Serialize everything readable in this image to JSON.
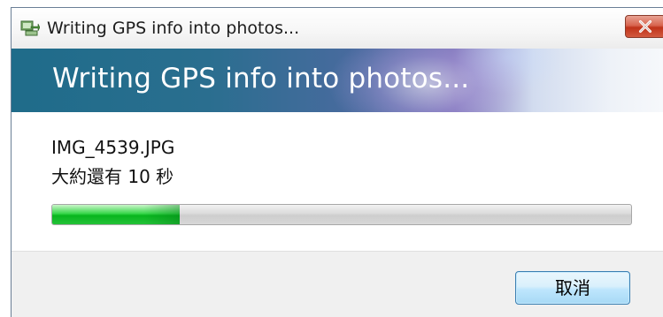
{
  "window": {
    "title": "Writing GPS info into photos...",
    "app_icon": "photo-gps-icon",
    "close_icon": "close-icon"
  },
  "banner": {
    "title": "Writing GPS info into photos..."
  },
  "status": {
    "filename": "IMG_4539.JPG",
    "time_remaining": "大約還有 10 秒"
  },
  "progress": {
    "fraction": 0.22,
    "fill_color": "#08b51e"
  },
  "buttons": {
    "cancel_label": "取消"
  },
  "colors": {
    "banner_dark": "#1f6c8a",
    "close_red": "#c0331a",
    "button_border": "#3c7fb1"
  }
}
